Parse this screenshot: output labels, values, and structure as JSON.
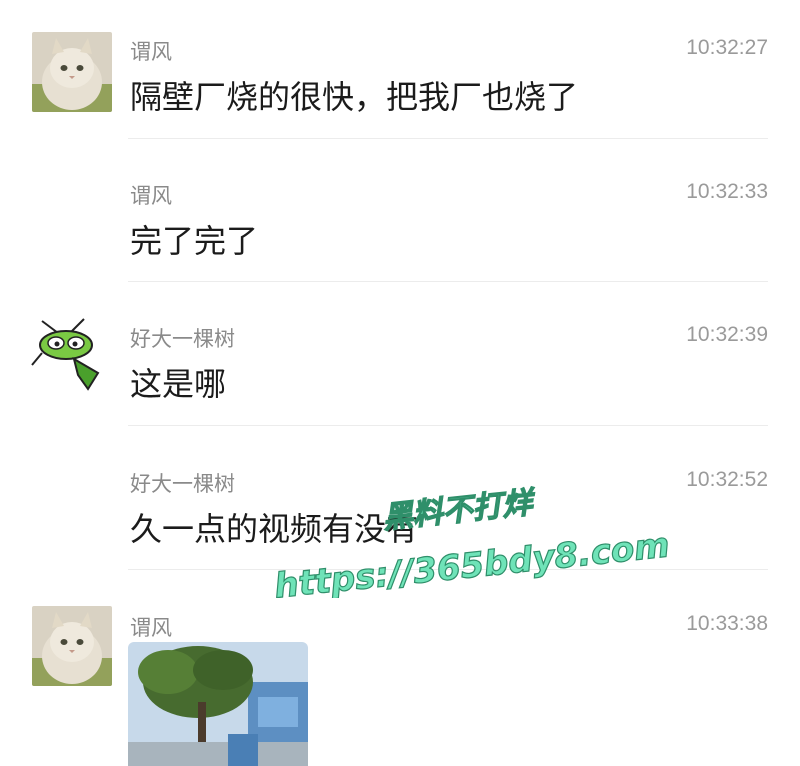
{
  "messages": [
    {
      "sender": "谓风",
      "time": "10:32:27",
      "text": "隔壁厂烧的很快，把我厂也烧了",
      "avatar": "cat-avatar-icon"
    },
    {
      "sender": "谓风",
      "time": "10:32:33",
      "text": "完了完了",
      "avatar": ""
    },
    {
      "sender": "好大一棵树",
      "time": "10:32:39",
      "text": "这是哪",
      "avatar": "mantis-avatar-icon"
    },
    {
      "sender": "好大一棵树",
      "time": "10:32:52",
      "text": "久一点的视频有没有",
      "avatar": ""
    },
    {
      "sender": "谓风",
      "time": "10:33:38",
      "text": "",
      "avatar": "cat-avatar-icon",
      "attachment": "photo-thumbnail"
    }
  ],
  "watermark": {
    "line1": "黑料不打烊",
    "line2": "https://365bdy8.com",
    "color": "#6fe3b8"
  }
}
